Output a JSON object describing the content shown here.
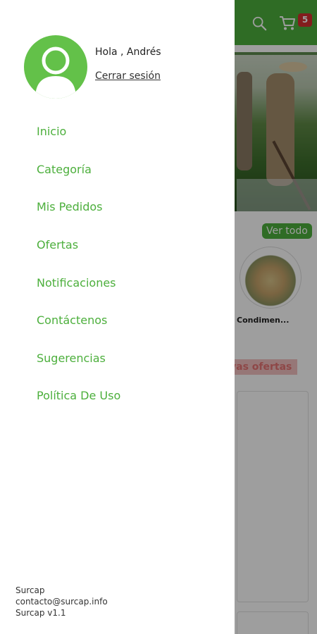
{
  "app": {
    "cart_count": "5",
    "section_action": "Ver todo",
    "category_label": "Condimen...",
    "offers_title": "vas ofertas",
    "colors": {
      "brand": "#4caf3c",
      "badge": "#d32f2f",
      "scrim": "rgba(0,0,0,0.38)"
    },
    "icons": [
      "search-icon",
      "cart-icon"
    ]
  },
  "drawer": {
    "greeting": "Hola , Andrés",
    "logout_label": "Cerrar sesión",
    "menu": [
      {
        "label": "Inicio"
      },
      {
        "label": "Categoría"
      },
      {
        "label": "Mis Pedidos"
      },
      {
        "label": "Ofertas"
      },
      {
        "label": "Notificaciones"
      },
      {
        "label": "Contáctenos"
      },
      {
        "label": "Sugerencias"
      },
      {
        "label": "Política De Uso"
      }
    ],
    "footer": {
      "company": "Surcap",
      "email": "contacto@surcap.info",
      "version": "Surcap v1.1"
    }
  }
}
